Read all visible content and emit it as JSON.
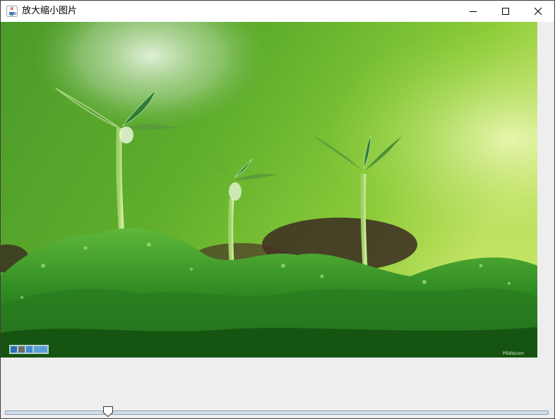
{
  "window": {
    "title": "放大缩小图片",
    "app_icon": "java-coffee-cup-icon",
    "controls": [
      "minimize-icon",
      "maximize-icon",
      "close-icon"
    ]
  },
  "image": {
    "subject": "green seedlings sprouting from moss",
    "watermark_text": "Pilidiscom"
  },
  "slider": {
    "value_fraction": 0.19
  },
  "colors": {
    "window_bg": "#eeeeee",
    "titlebar_bg": "#ffffff",
    "slider_track": "#d6e0ea",
    "slider_border": "#8a9fb4"
  }
}
